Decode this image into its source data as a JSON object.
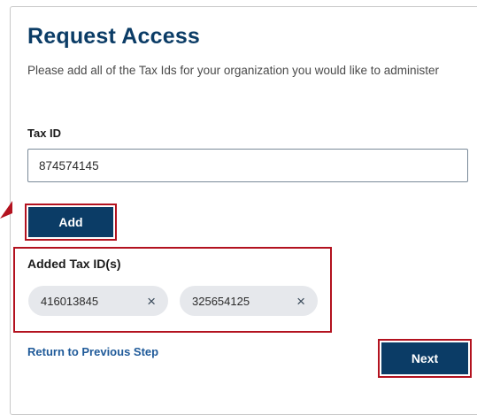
{
  "header": {
    "title": "Request Access",
    "subtitle": "Please add all of the Tax Ids for your organization you would like to administer"
  },
  "tax_id_field": {
    "label": "Tax ID",
    "value": "874574145"
  },
  "add_button": {
    "label": "Add"
  },
  "added_section": {
    "label": "Added Tax ID(s)",
    "chips": [
      {
        "value": "416013845",
        "remove_icon": "×"
      },
      {
        "value": "325654125",
        "remove_icon": "×"
      }
    ]
  },
  "footer": {
    "back_link": "Return to Previous Step",
    "next_label": "Next"
  },
  "colors": {
    "primary": "#0b3c66",
    "highlight": "#b3121f",
    "link": "#1f5a99",
    "chip_bg": "#e6e8ec"
  },
  "icons": {
    "chip_remove": "close-icon",
    "annotation": "pointer-arrow-icon"
  }
}
